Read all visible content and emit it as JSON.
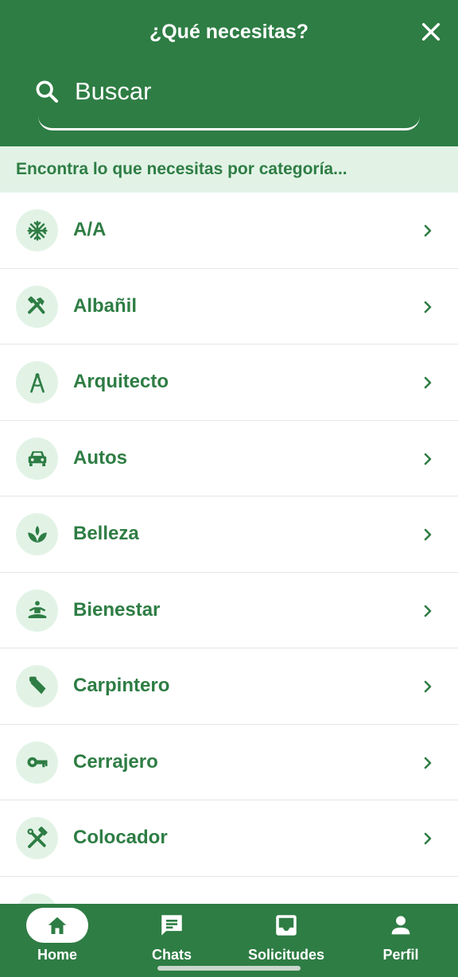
{
  "header": {
    "title": "¿Qué necesitas?",
    "close_icon": "close-icon",
    "search": {
      "placeholder": "Buscar",
      "value": ""
    }
  },
  "banner": {
    "text": "Encontra lo que necesitas por categoría..."
  },
  "categories": [
    {
      "label": "A/A",
      "icon": "snowflake-icon"
    },
    {
      "label": "Albañil",
      "icon": "tools-icon"
    },
    {
      "label": "Arquitecto",
      "icon": "compass-icon"
    },
    {
      "label": "Autos",
      "icon": "car-icon"
    },
    {
      "label": "Belleza",
      "icon": "spa-icon"
    },
    {
      "label": "Bienestar",
      "icon": "meditation-icon"
    },
    {
      "label": "Carpintero",
      "icon": "saw-icon"
    },
    {
      "label": "Cerrajero",
      "icon": "key-icon"
    },
    {
      "label": "Colocador",
      "icon": "hammer-wrench-icon"
    }
  ],
  "bottom_nav": [
    {
      "label": "Home",
      "icon": "home-icon",
      "active": true
    },
    {
      "label": "Chats",
      "icon": "chat-icon",
      "active": false
    },
    {
      "label": "Solicitudes",
      "icon": "inbox-icon",
      "active": false
    },
    {
      "label": "Perfil",
      "icon": "person-icon",
      "active": false
    }
  ],
  "colors": {
    "primary": "#2e7d44",
    "light": "#e2f3e6",
    "white": "#ffffff"
  }
}
